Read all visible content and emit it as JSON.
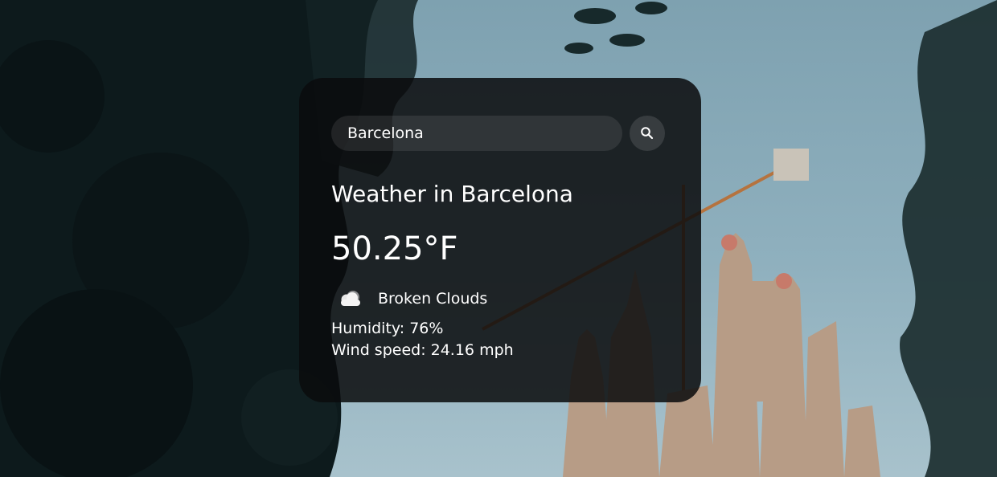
{
  "search": {
    "value": "Barcelona",
    "icon": "search-icon"
  },
  "weather": {
    "title": "Weather in Barcelona",
    "temperature": "50.25°F",
    "condition_icon": "cloud-icon",
    "condition": "Broken Clouds",
    "humidity": "Humidity: 76%",
    "wind": "Wind speed: 24.16 mph"
  },
  "colors": {
    "card_background": "#0a0c0d",
    "text": "#ffffff",
    "sky": "#8fb0be"
  }
}
